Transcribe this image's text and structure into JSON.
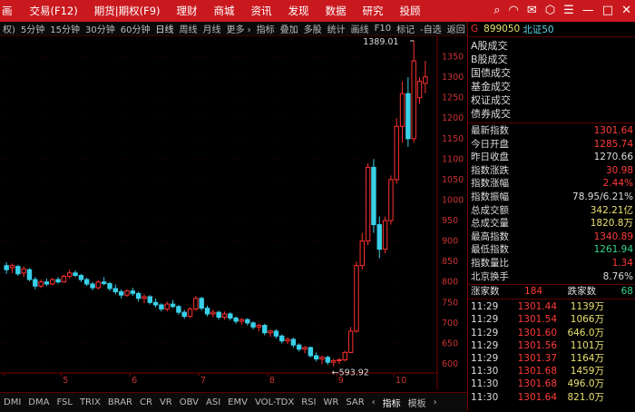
{
  "menu": [
    "画",
    "交易(F12)",
    "期货|期权(F9)",
    "理财",
    "商城",
    "资讯",
    "发现",
    "数据",
    "研究",
    "投顾"
  ],
  "icons": [
    "search-icon",
    "headset-icon",
    "mail-icon",
    "box-icon",
    "menu-icon",
    "minimize-icon",
    "maximize-icon",
    "close-icon"
  ],
  "icon_glyphs": [
    "⌕",
    "◠",
    "✉",
    "⬡",
    "☰",
    "—",
    "□",
    "✕"
  ],
  "toolbar": {
    "left": "权)",
    "periods": [
      "5分钟",
      "15分钟",
      "30分钟",
      "60分钟",
      "日线",
      "周线",
      "月线",
      "更多 ›"
    ],
    "active_period": "日线",
    "right": [
      "指标",
      "叠加",
      "多股",
      "统计",
      "画线",
      "F10",
      "标记",
      "-自选",
      "返回"
    ]
  },
  "indicator_bar": [
    "DMI",
    "DMA",
    "FSL",
    "TRIX",
    "BRAR",
    "CR",
    "VR",
    "OBV",
    "ASI",
    "EMV",
    "VOL-TDX",
    "RSI",
    "WR",
    "SAR",
    "‹",
    "指标",
    "模板",
    "›"
  ],
  "indicator_selected": "指标",
  "chart_data": {
    "type": "candlestick",
    "title": "",
    "x_ticks": [
      "",
      "5",
      "6",
      "7",
      "8",
      "9",
      "10"
    ],
    "y_ticks": [
      600,
      650,
      700,
      750,
      800,
      850,
      900,
      950,
      1000,
      1050,
      1100,
      1150,
      1200,
      1250,
      1300,
      1350
    ],
    "ylim": [
      580,
      1400
    ],
    "annotations": [
      {
        "text": "1389.01",
        "value": 1389.01
      },
      {
        "text": "←593.92",
        "value": 593.92
      }
    ],
    "candles": [
      {
        "o": 840,
        "h": 848,
        "l": 820,
        "c": 830
      },
      {
        "o": 835,
        "h": 845,
        "l": 822,
        "c": 840
      },
      {
        "o": 838,
        "h": 842,
        "l": 815,
        "c": 820
      },
      {
        "o": 822,
        "h": 838,
        "l": 812,
        "c": 832
      },
      {
        "o": 830,
        "h": 834,
        "l": 802,
        "c": 806
      },
      {
        "o": 806,
        "h": 812,
        "l": 782,
        "c": 790
      },
      {
        "o": 790,
        "h": 806,
        "l": 785,
        "c": 800
      },
      {
        "o": 800,
        "h": 808,
        "l": 790,
        "c": 795
      },
      {
        "o": 795,
        "h": 810,
        "l": 792,
        "c": 806
      },
      {
        "o": 806,
        "h": 812,
        "l": 796,
        "c": 800
      },
      {
        "o": 800,
        "h": 818,
        "l": 798,
        "c": 814
      },
      {
        "o": 814,
        "h": 830,
        "l": 808,
        "c": 822
      },
      {
        "o": 822,
        "h": 828,
        "l": 812,
        "c": 816
      },
      {
        "o": 816,
        "h": 820,
        "l": 800,
        "c": 806
      },
      {
        "o": 806,
        "h": 810,
        "l": 790,
        "c": 795
      },
      {
        "o": 795,
        "h": 800,
        "l": 780,
        "c": 786
      },
      {
        "o": 786,
        "h": 804,
        "l": 782,
        "c": 800
      },
      {
        "o": 800,
        "h": 812,
        "l": 792,
        "c": 796
      },
      {
        "o": 796,
        "h": 800,
        "l": 778,
        "c": 784
      },
      {
        "o": 784,
        "h": 794,
        "l": 770,
        "c": 776
      },
      {
        "o": 776,
        "h": 782,
        "l": 760,
        "c": 768
      },
      {
        "o": 768,
        "h": 782,
        "l": 764,
        "c": 778
      },
      {
        "o": 778,
        "h": 786,
        "l": 766,
        "c": 772
      },
      {
        "o": 772,
        "h": 776,
        "l": 752,
        "c": 760
      },
      {
        "o": 760,
        "h": 770,
        "l": 748,
        "c": 764
      },
      {
        "o": 764,
        "h": 768,
        "l": 745,
        "c": 750
      },
      {
        "o": 750,
        "h": 760,
        "l": 738,
        "c": 744
      },
      {
        "o": 744,
        "h": 748,
        "l": 728,
        "c": 734
      },
      {
        "o": 734,
        "h": 752,
        "l": 728,
        "c": 746
      },
      {
        "o": 746,
        "h": 756,
        "l": 736,
        "c": 740
      },
      {
        "o": 740,
        "h": 744,
        "l": 720,
        "c": 726
      },
      {
        "o": 726,
        "h": 732,
        "l": 710,
        "c": 716
      },
      {
        "o": 716,
        "h": 738,
        "l": 712,
        "c": 734
      },
      {
        "o": 734,
        "h": 766,
        "l": 730,
        "c": 760
      },
      {
        "o": 760,
        "h": 764,
        "l": 730,
        "c": 736
      },
      {
        "o": 736,
        "h": 742,
        "l": 716,
        "c": 722
      },
      {
        "o": 722,
        "h": 732,
        "l": 714,
        "c": 726
      },
      {
        "o": 726,
        "h": 730,
        "l": 708,
        "c": 714
      },
      {
        "o": 714,
        "h": 728,
        "l": 708,
        "c": 722
      },
      {
        "o": 722,
        "h": 726,
        "l": 706,
        "c": 712
      },
      {
        "o": 712,
        "h": 716,
        "l": 698,
        "c": 704
      },
      {
        "o": 704,
        "h": 712,
        "l": 696,
        "c": 708
      },
      {
        "o": 708,
        "h": 712,
        "l": 694,
        "c": 700
      },
      {
        "o": 700,
        "h": 704,
        "l": 684,
        "c": 690
      },
      {
        "o": 690,
        "h": 698,
        "l": 680,
        "c": 694
      },
      {
        "o": 694,
        "h": 698,
        "l": 670,
        "c": 676
      },
      {
        "o": 676,
        "h": 684,
        "l": 666,
        "c": 680
      },
      {
        "o": 680,
        "h": 684,
        "l": 662,
        "c": 668
      },
      {
        "o": 668,
        "h": 672,
        "l": 650,
        "c": 656
      },
      {
        "o": 656,
        "h": 664,
        "l": 648,
        "c": 660
      },
      {
        "o": 660,
        "h": 664,
        "l": 640,
        "c": 646
      },
      {
        "o": 646,
        "h": 650,
        "l": 630,
        "c": 636
      },
      {
        "o": 636,
        "h": 644,
        "l": 626,
        "c": 640
      },
      {
        "o": 640,
        "h": 642,
        "l": 616,
        "c": 620
      },
      {
        "o": 620,
        "h": 628,
        "l": 606,
        "c": 612
      },
      {
        "o": 612,
        "h": 620,
        "l": 600,
        "c": 616
      },
      {
        "o": 616,
        "h": 620,
        "l": 598,
        "c": 604
      },
      {
        "o": 604,
        "h": 612,
        "l": 594,
        "c": 608
      },
      {
        "o": 608,
        "h": 614,
        "l": 600,
        "c": 610
      },
      {
        "o": 610,
        "h": 632,
        "l": 606,
        "c": 628
      },
      {
        "o": 628,
        "h": 690,
        "l": 626,
        "c": 680
      },
      {
        "o": 680,
        "h": 850,
        "l": 676,
        "c": 840
      },
      {
        "o": 840,
        "h": 920,
        "l": 830,
        "c": 900
      },
      {
        "o": 900,
        "h": 1090,
        "l": 890,
        "c": 1080
      },
      {
        "o": 1080,
        "h": 1100,
        "l": 920,
        "c": 940
      },
      {
        "o": 940,
        "h": 960,
        "l": 858,
        "c": 880
      },
      {
        "o": 880,
        "h": 960,
        "l": 870,
        "c": 950
      },
      {
        "o": 950,
        "h": 1060,
        "l": 940,
        "c": 1050
      },
      {
        "o": 1050,
        "h": 1200,
        "l": 1040,
        "c": 1180
      },
      {
        "o": 1180,
        "h": 1290,
        "l": 1140,
        "c": 1260
      },
      {
        "o": 1260,
        "h": 1300,
        "l": 1130,
        "c": 1150
      },
      {
        "o": 1150,
        "h": 1389,
        "l": 1140,
        "c": 1340
      },
      {
        "o": 1250,
        "h": 1300,
        "l": 1235,
        "c": 1290
      },
      {
        "o": 1285,
        "h": 1340,
        "l": 1261,
        "c": 1301
      }
    ]
  },
  "sidebar": {
    "marker": "G",
    "code": "899050",
    "name": "北证50",
    "categories": [
      "A股成交",
      "B股成交",
      "国债成交",
      "基金成交",
      "权证成交",
      "债券成交"
    ],
    "stats": [
      {
        "k": "最新指数",
        "v": "1301.64",
        "c": "up"
      },
      {
        "k": "今日开盘",
        "v": "1285.74",
        "c": "up"
      },
      {
        "k": "昨日收盘",
        "v": "1270.66",
        "c": "wh"
      },
      {
        "k": "指数涨跌",
        "v": "30.98",
        "c": "up"
      },
      {
        "k": "指数涨幅",
        "v": "2.44%",
        "c": "up"
      },
      {
        "k": "指数振幅",
        "v": "78.95/6.21%",
        "c": "wh"
      },
      {
        "k": "总成交额",
        "v": "342.21亿",
        "c": "yel"
      },
      {
        "k": "总成交量",
        "v": "1820.8万",
        "c": "yel"
      },
      {
        "k": "最高指数",
        "v": "1340.89",
        "c": "up"
      },
      {
        "k": "最低指数",
        "v": "1261.94",
        "c": "down"
      },
      {
        "k": "指数量比",
        "v": "1.34",
        "c": "up"
      },
      {
        "k": "北京换手",
        "v": "8.76%",
        "c": "wh"
      }
    ],
    "rise_label": "涨家数",
    "rise_count": "184",
    "fall_label": "跌家数",
    "fall_count": "68",
    "ticks": [
      {
        "t": "11:29",
        "p": "1301.44",
        "v": "1139万"
      },
      {
        "t": "11:29",
        "p": "1301.54",
        "v": "1066万"
      },
      {
        "t": "11:29",
        "p": "1301.60",
        "v": "646.0万"
      },
      {
        "t": "11:29",
        "p": "1301.56",
        "v": "1101万"
      },
      {
        "t": "11:29",
        "p": "1301.37",
        "v": "1164万"
      },
      {
        "t": "11:30",
        "p": "1301.68",
        "v": "1459万"
      },
      {
        "t": "11:30",
        "p": "1301.68",
        "v": "496.0万"
      },
      {
        "t": "11:30",
        "p": "1301.64",
        "v": "821.0万"
      }
    ]
  }
}
